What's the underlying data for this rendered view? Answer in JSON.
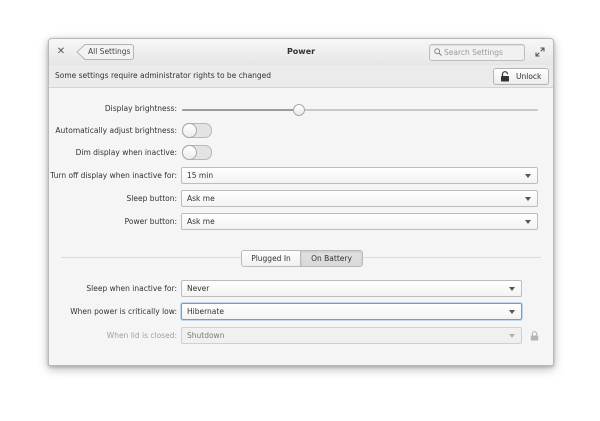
{
  "window": {
    "title": "Power",
    "back_label": "All Settings",
    "search_placeholder": "Search Settings"
  },
  "infobar": {
    "message": "Some settings require administrator rights to be changed",
    "unlock_label": "Unlock"
  },
  "display": {
    "brightness_label": "Display brightness:",
    "brightness_level": 0.33,
    "auto_brightness_label": "Automatically adjust brightness:",
    "auto_brightness_on": false,
    "dim_label": "Dim display when inactive:",
    "dim_on": false,
    "turn_off_label": "Turn off display when inactive for:",
    "turn_off_value": "15 min",
    "sleep_button_label": "Sleep button:",
    "sleep_button_value": "Ask me",
    "power_button_label": "Power button:",
    "power_button_value": "Ask me"
  },
  "power_mode": {
    "tabs": [
      "Plugged In",
      "On Battery"
    ],
    "selected": "On Battery"
  },
  "battery": {
    "sleep_label": "Sleep when inactive for:",
    "sleep_value": "Never",
    "critical_label": "When power is critically low:",
    "critical_value": "Hibernate",
    "lid_label": "When lid is closed:",
    "lid_value": "Shutdown"
  },
  "colors": {
    "focus": "#6b9fd8",
    "disabled_text": "#a0a0a0"
  }
}
